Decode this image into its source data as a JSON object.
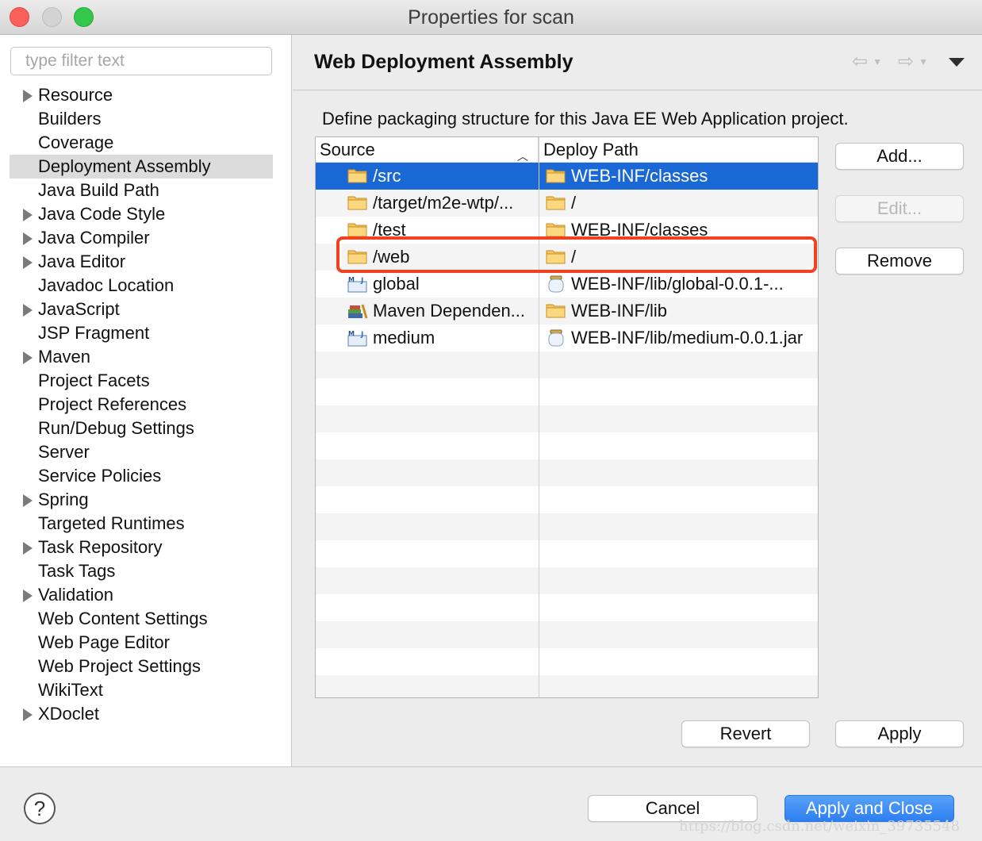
{
  "window": {
    "title": "Properties for scan"
  },
  "sidebar": {
    "filter_placeholder": "type filter text",
    "items": [
      {
        "label": "Resource",
        "expandable": true
      },
      {
        "label": "Builders",
        "expandable": false
      },
      {
        "label": "Coverage",
        "expandable": false
      },
      {
        "label": "Deployment Assembly",
        "expandable": false,
        "selected": true
      },
      {
        "label": "Java Build Path",
        "expandable": false
      },
      {
        "label": "Java Code Style",
        "expandable": true
      },
      {
        "label": "Java Compiler",
        "expandable": true
      },
      {
        "label": "Java Editor",
        "expandable": true
      },
      {
        "label": "Javadoc Location",
        "expandable": false
      },
      {
        "label": "JavaScript",
        "expandable": true
      },
      {
        "label": "JSP Fragment",
        "expandable": false
      },
      {
        "label": "Maven",
        "expandable": true
      },
      {
        "label": "Project Facets",
        "expandable": false
      },
      {
        "label": "Project References",
        "expandable": false
      },
      {
        "label": "Run/Debug Settings",
        "expandable": false
      },
      {
        "label": "Server",
        "expandable": false
      },
      {
        "label": "Service Policies",
        "expandable": false
      },
      {
        "label": "Spring",
        "expandable": true
      },
      {
        "label": "Targeted Runtimes",
        "expandable": false
      },
      {
        "label": "Task Repository",
        "expandable": true
      },
      {
        "label": "Task Tags",
        "expandable": false
      },
      {
        "label": "Validation",
        "expandable": true
      },
      {
        "label": "Web Content Settings",
        "expandable": false
      },
      {
        "label": "Web Page Editor",
        "expandable": false
      },
      {
        "label": "Web Project Settings",
        "expandable": false
      },
      {
        "label": "WikiText",
        "expandable": false
      },
      {
        "label": "XDoclet",
        "expandable": true
      }
    ]
  },
  "main": {
    "title": "Web Deployment Assembly",
    "description": "Define packaging structure for this Java EE Web Application project.",
    "table": {
      "headers": {
        "source": "Source",
        "deploy_path": "Deploy Path"
      },
      "rows": [
        {
          "source": "/src",
          "source_icon": "folder-icon",
          "deploy": "WEB-INF/classes",
          "deploy_icon": "folder-icon",
          "selected": true
        },
        {
          "source": "/target/m2e-wtp/...",
          "source_icon": "folder-icon",
          "deploy": "/",
          "deploy_icon": "folder-icon"
        },
        {
          "source": "/test",
          "source_icon": "folder-icon",
          "deploy": "WEB-INF/classes",
          "deploy_icon": "folder-icon"
        },
        {
          "source": "/web",
          "source_icon": "folder-icon",
          "deploy": "/",
          "deploy_icon": "folder-icon",
          "highlighted": true
        },
        {
          "source": "global",
          "source_icon": "maven-project-icon",
          "deploy": "WEB-INF/lib/global-0.0.1-...",
          "deploy_icon": "jar-icon"
        },
        {
          "source": "Maven Dependen...",
          "source_icon": "library-icon",
          "deploy": "WEB-INF/lib",
          "deploy_icon": "folder-icon"
        },
        {
          "source": "medium",
          "source_icon": "maven-project-icon",
          "deploy": "WEB-INF/lib/medium-0.0.1.jar",
          "deploy_icon": "jar-icon"
        }
      ],
      "empty_rows": 13
    },
    "buttons": {
      "add": "Add...",
      "edit": "Edit...",
      "remove": "Remove",
      "revert": "Revert",
      "apply": "Apply"
    }
  },
  "footer": {
    "help": "?",
    "cancel": "Cancel",
    "apply_close": "Apply and Close",
    "watermark": "https://blog.csdn.net/weixin_39735548"
  },
  "colors": {
    "selection": "#1a68d5",
    "highlight_box": "#f0421f",
    "primary_button": "#3b8cf5"
  }
}
